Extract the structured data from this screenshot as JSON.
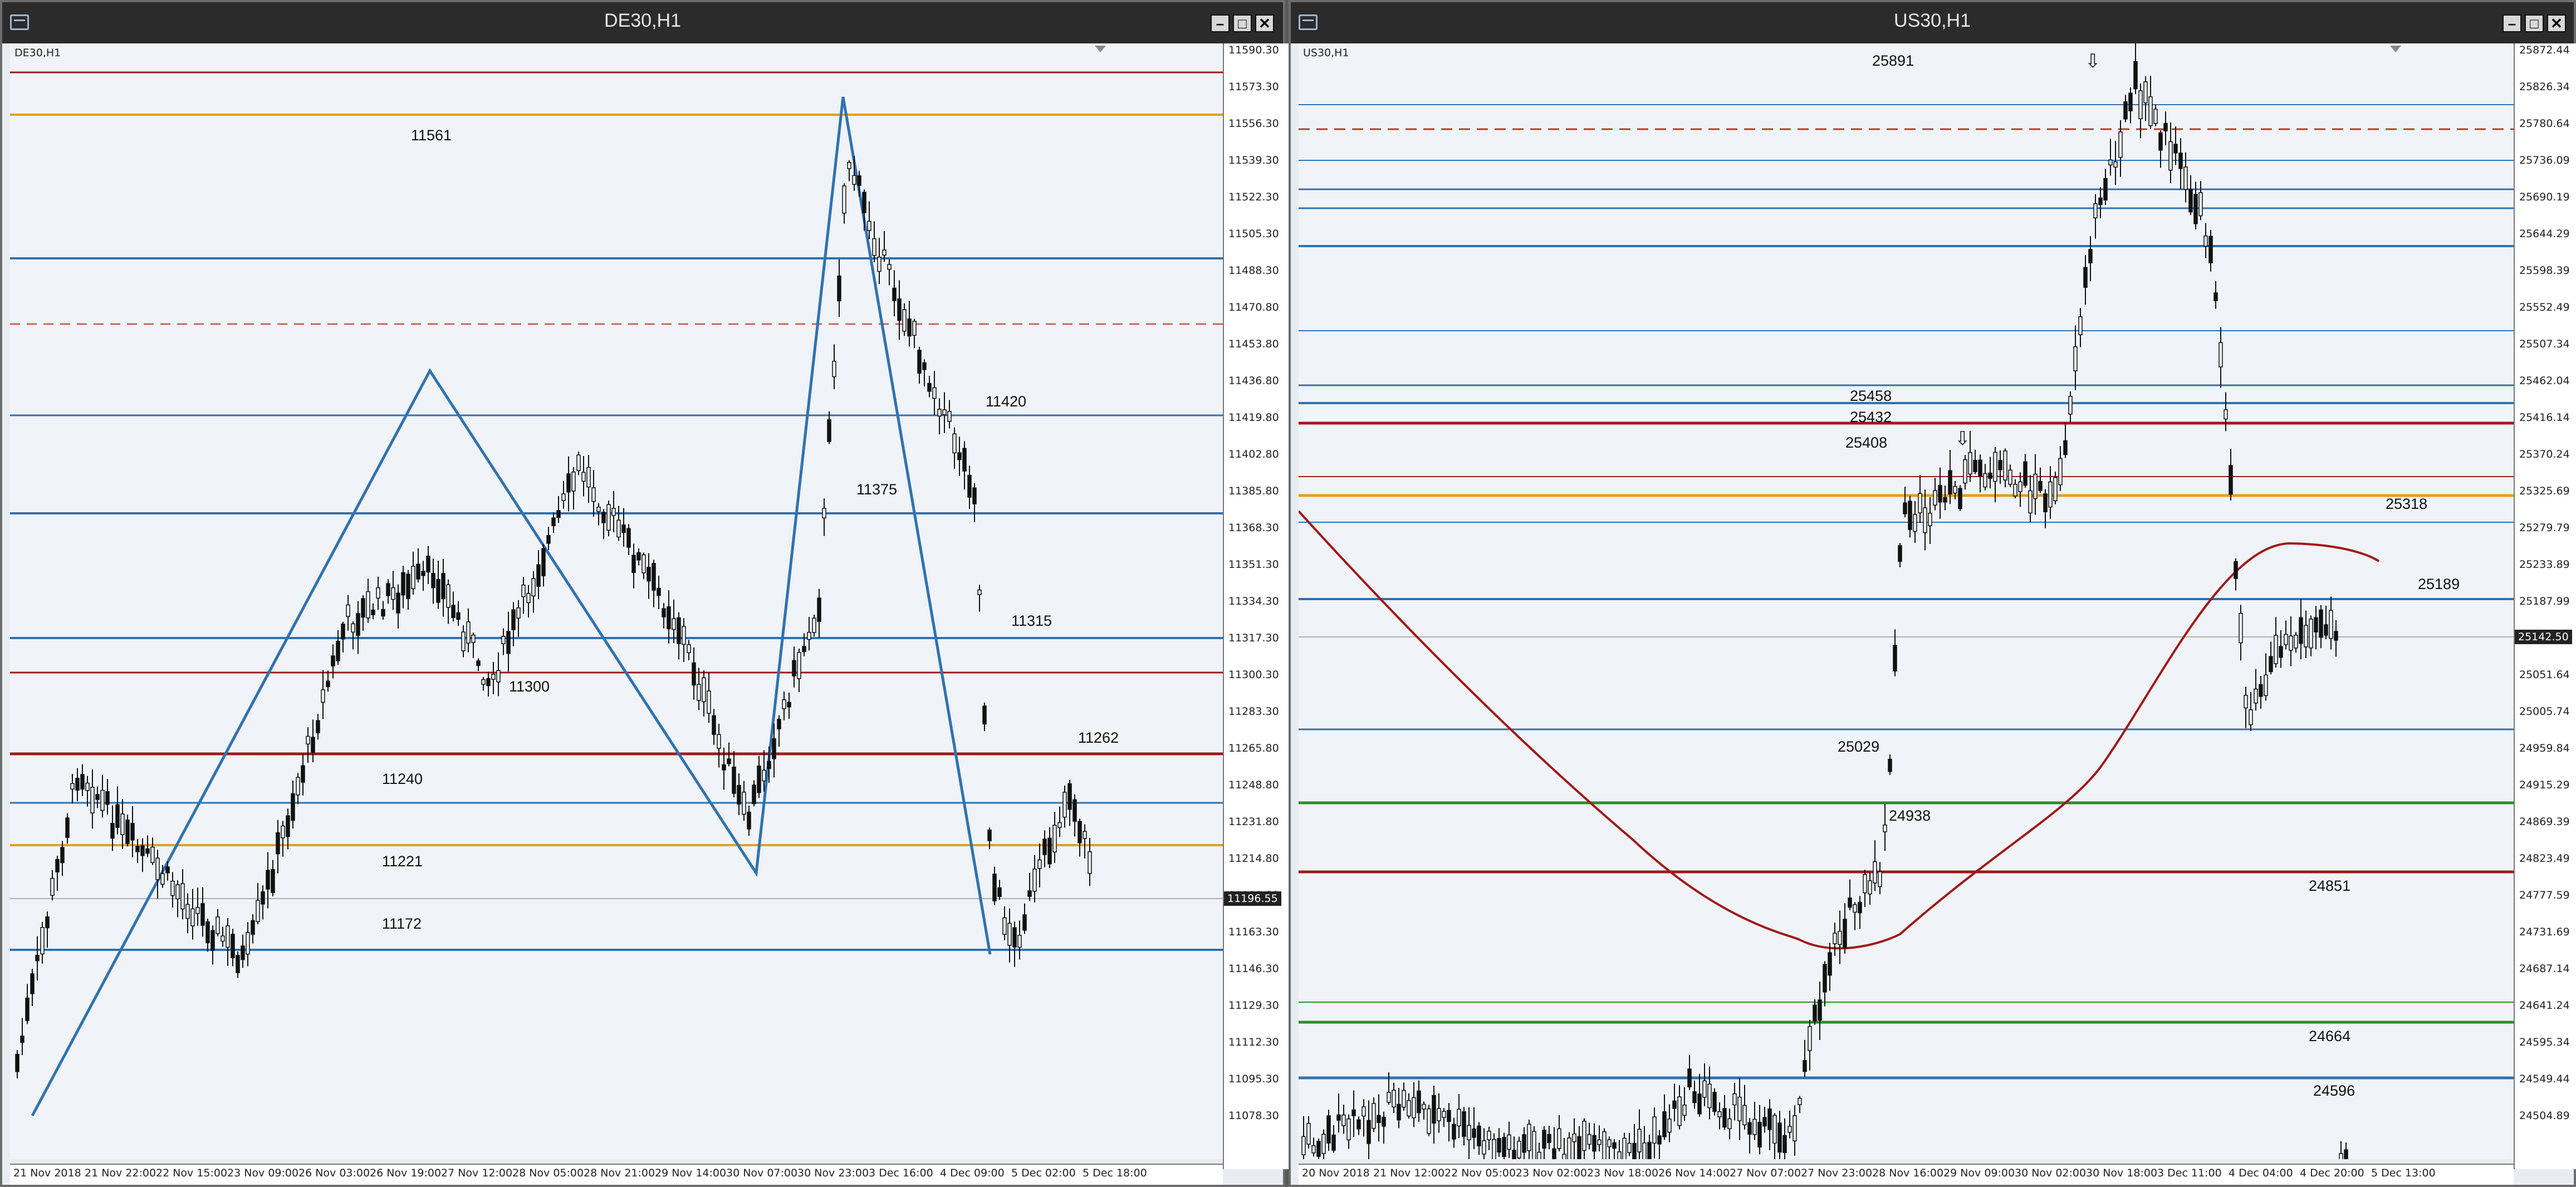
{
  "left": {
    "title": "DE30,H1",
    "symbol_label": "DE30,H1",
    "current_price": "11196.55",
    "y_ticks": [
      "11590.30",
      "11573.30",
      "11556.30",
      "11539.30",
      "11522.30",
      "11505.30",
      "11488.30",
      "11470.80",
      "11453.80",
      "11436.80",
      "11419.80",
      "11402.80",
      "11385.80",
      "11368.30",
      "11351.30",
      "11334.30",
      "11317.30",
      "11300.30",
      "11283.30",
      "11265.80",
      "11248.80",
      "11231.80",
      "11214.80",
      "11180.80",
      "11163.30",
      "11146.30",
      "11129.30",
      "11112.30",
      "11095.30",
      "11078.30"
    ],
    "x_ticks": [
      "21 Nov 2018",
      "21 Nov 22:00",
      "22 Nov 15:00",
      "23 Nov 09:00",
      "26 Nov 03:00",
      "26 Nov 19:00",
      "27 Nov 12:00",
      "28 Nov 05:00",
      "28 Nov 21:00",
      "29 Nov 14:00",
      "30 Nov 07:00",
      "30 Nov 23:00",
      "3 Dec 16:00",
      "4 Dec 09:00",
      "5 Dec 02:00",
      "5 Dec 18:00"
    ],
    "level_labels": [
      "11561",
      "11420",
      "11375",
      "11315",
      "11300",
      "11262",
      "11240",
      "11221",
      "11172"
    ]
  },
  "right": {
    "title": "US30,H1",
    "symbol_label": "US30,H1",
    "current_price": "25142.50",
    "y_ticks": [
      "25872.44",
      "25826.34",
      "25780.64",
      "25736.09",
      "25690.19",
      "25644.29",
      "25598.39",
      "25552.49",
      "25507.34",
      "25462.04",
      "25416.14",
      "25370.24",
      "25325.69",
      "25279.79",
      "25233.89",
      "25187.99",
      "25097.54",
      "25051.64",
      "25005.74",
      "24959.84",
      "24915.29",
      "24869.39",
      "24823.49",
      "24777.59",
      "24731.69",
      "24687.14",
      "24641.24",
      "24595.34",
      "24549.44",
      "24504.89"
    ],
    "x_ticks": [
      "20 Nov 2018",
      "21 Nov 12:00",
      "22 Nov 05:00",
      "23 Nov 02:00",
      "23 Nov 18:00",
      "26 Nov 14:00",
      "27 Nov 07:00",
      "27 Nov 23:00",
      "28 Nov 16:00",
      "29 Nov 09:00",
      "30 Nov 02:00",
      "30 Nov 18:00",
      "3 Dec 11:00",
      "4 Dec 04:00",
      "4 Dec 20:00",
      "5 Dec 13:00"
    ],
    "level_labels": [
      "25891",
      "25458",
      "25432",
      "25408",
      "25318",
      "25189",
      "25029",
      "24938",
      "24851",
      "24664",
      "24596"
    ]
  },
  "colors": {
    "blue": "#2f72b0",
    "red": "#9c1a1a",
    "orange": "#e0a020",
    "green": "#2f8a2f",
    "dashed": "#c0392b",
    "ma": "#a01818"
  }
}
